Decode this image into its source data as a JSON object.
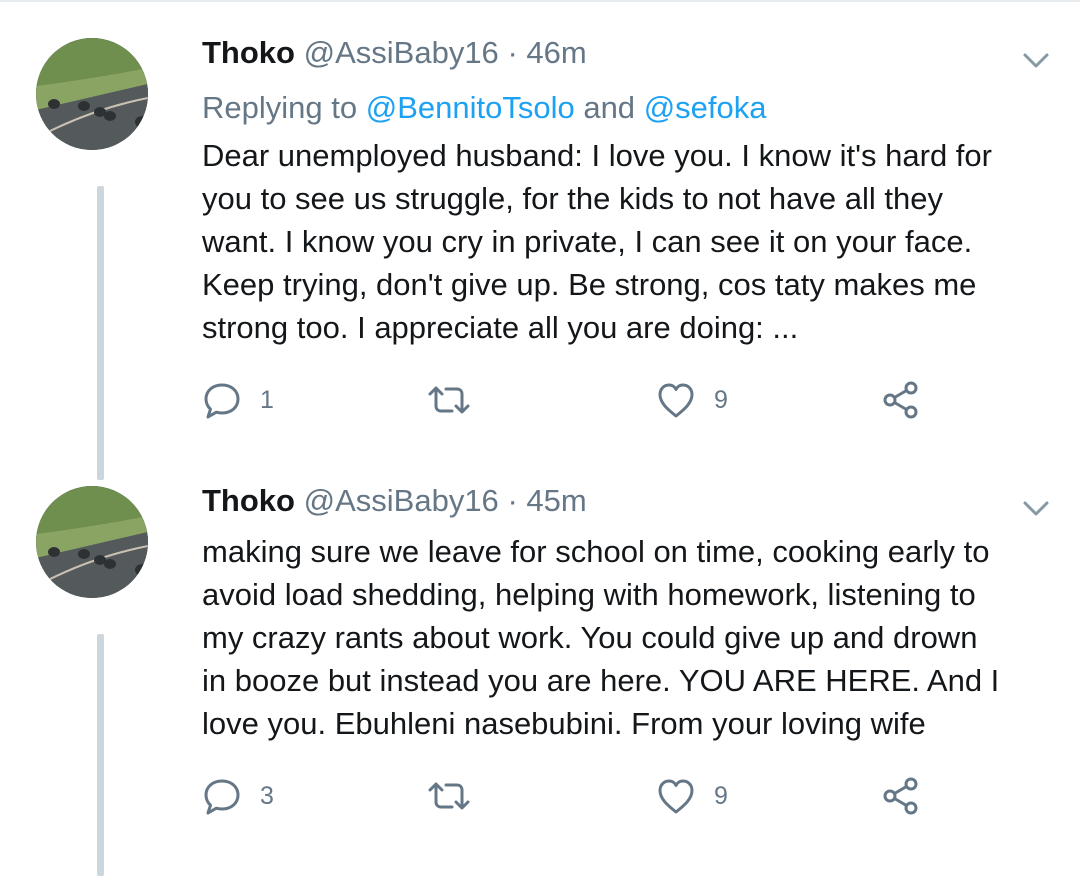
{
  "tweets": [
    {
      "author_name": "Thoko",
      "handle": "@AssiBaby16",
      "separator": "·",
      "time": "46m",
      "reply_prefix": "Replying to",
      "reply_mention_1": "@BennitoTsolo",
      "reply_conj": "and",
      "reply_mention_2": "@sefoka",
      "text": "Dear unemployed husband: I love you. I know it's hard for\nyou to see us struggle, for the kids to not have all they\nwant. I know you cry in private, I can see it on your face.\nKeep trying, don't give up. Be strong, cos taty makes me\nstrong too. I appreciate all you are doing: ...",
      "reply_count": "1",
      "like_count": "9"
    },
    {
      "author_name": "Thoko",
      "handle": "@AssiBaby16",
      "separator": "·",
      "time": "45m",
      "text": "making sure we leave for school on time, cooking early to\navoid load shedding, helping with homework, listening to\nmy crazy rants about work. You could give up and drown\nin booze but instead you are here. YOU ARE HERE. And I\nlove you. Ebuhleni nasebubini. From your loving wife",
      "reply_count": "3",
      "like_count": "9"
    }
  ],
  "icons": {
    "reply": "reply-icon",
    "retweet": "retweet-icon",
    "like": "heart-icon",
    "share": "share-icon",
    "menu": "chevron-down-icon"
  },
  "colors": {
    "text": "#14171a",
    "secondary": "#657786",
    "link": "#1da1f2",
    "thread_line": "#ccd6dd"
  }
}
